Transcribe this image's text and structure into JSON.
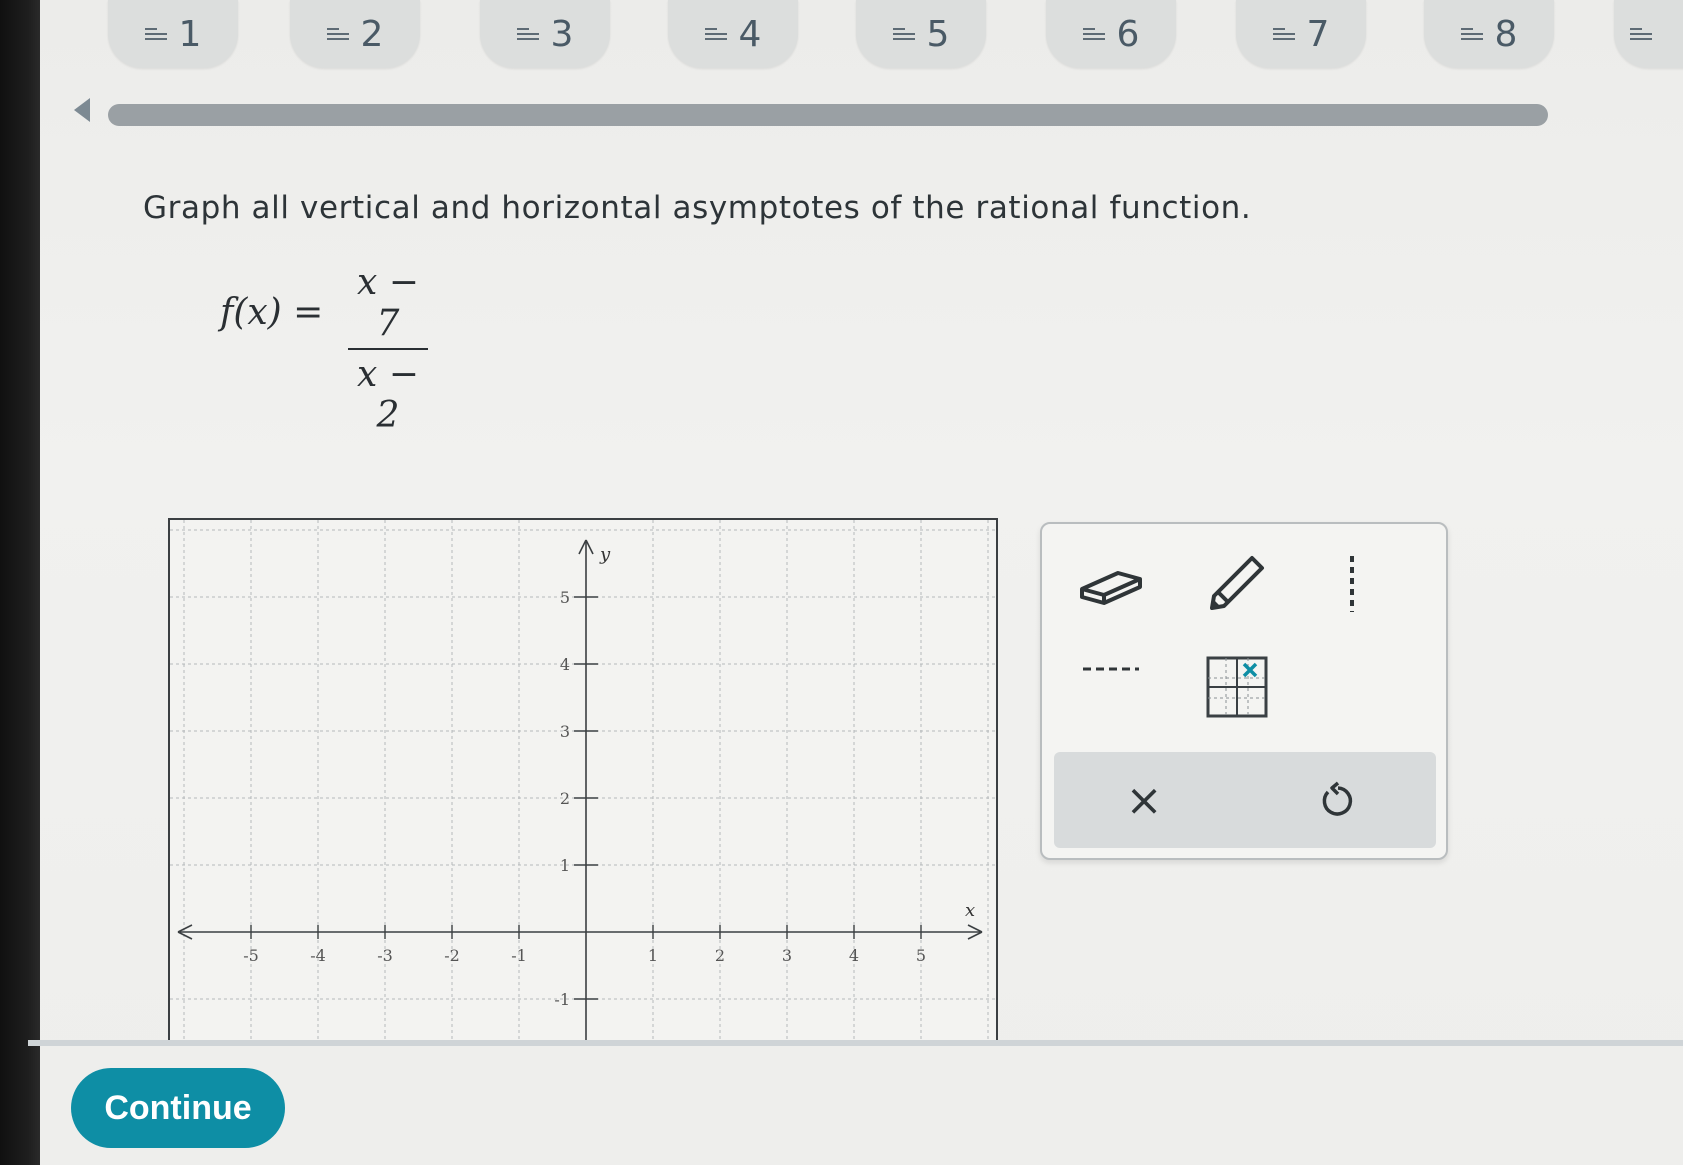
{
  "tabs": [
    {
      "label": "1"
    },
    {
      "label": "2"
    },
    {
      "label": "3"
    },
    {
      "label": "4"
    },
    {
      "label": "5"
    },
    {
      "label": "6"
    },
    {
      "label": "7"
    },
    {
      "label": "8"
    },
    {
      "label": ""
    }
  ],
  "question": {
    "prompt": "Graph all vertical and horizontal asymptotes of the rational function.",
    "function_lhs": "f(x) =",
    "numerator": "x − 7",
    "denominator": "x − 2"
  },
  "graph": {
    "x_axis_label": "x",
    "y_axis_label": "y",
    "x_ticks": [
      "-5",
      "-4",
      "-3",
      "-2",
      "-1",
      "1",
      "2",
      "3",
      "4",
      "5"
    ],
    "y_ticks": [
      "5",
      "4",
      "3",
      "2",
      "1",
      "-1"
    ],
    "x_range": [
      -6,
      6
    ],
    "y_range": [
      -2,
      6
    ]
  },
  "tools": {
    "eraser": "eraser-icon",
    "pencil": "pencil-icon",
    "vertical_dashed": "vertical-asymptote-icon",
    "horizontal_dashed": "horizontal-asymptote-icon",
    "grid_point": "grid-point-icon",
    "clear": "×",
    "undo": "undo-icon"
  },
  "footer": {
    "continue_label": "Continue"
  },
  "colors": {
    "accent": "#0e8ea5",
    "grid": "#b4b8ba",
    "axis": "#3b3f42"
  }
}
